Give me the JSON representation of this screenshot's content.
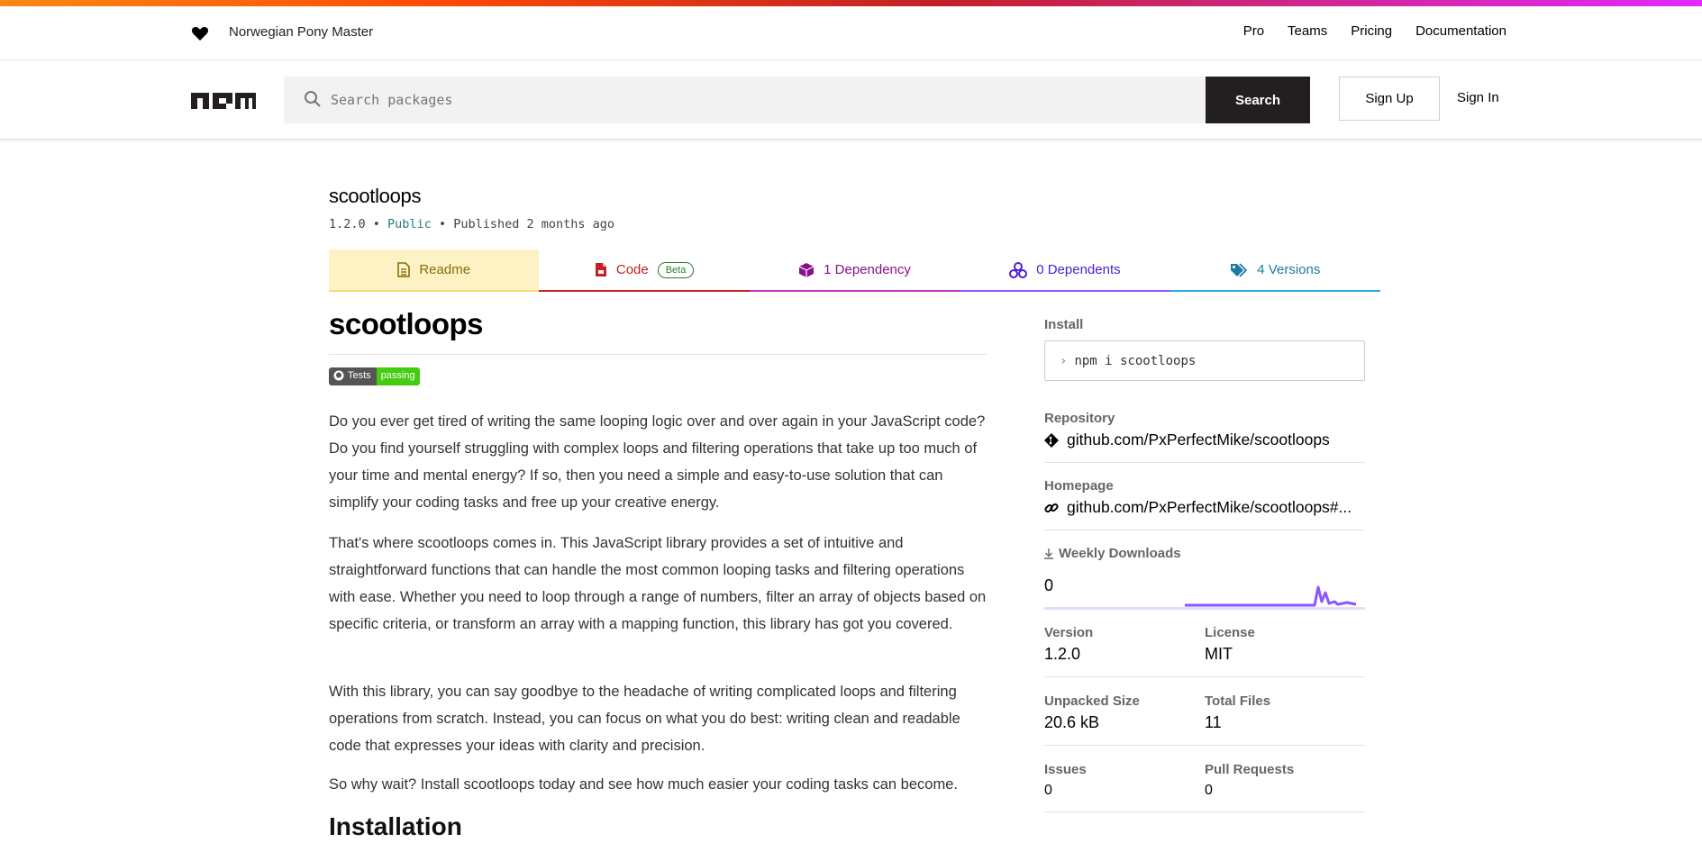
{
  "top_bar": {
    "tagline": "Norwegian Pony Master",
    "nav": [
      "Pro",
      "Teams",
      "Pricing",
      "Documentation"
    ]
  },
  "header": {
    "search_placeholder": "Search packages",
    "search_button": "Search",
    "signup_label": "Sign Up",
    "signin_label": "Sign In"
  },
  "package": {
    "name": "scootloops",
    "version": "1.2.0",
    "visibility": "Public",
    "published": "Published 2 months ago"
  },
  "tabs": {
    "readme": "Readme",
    "code": "Code",
    "code_badge": "Beta",
    "dependency": "1 Dependency",
    "dependents": "0 Dependents",
    "versions": "4 Versions"
  },
  "readme": {
    "title": "scootloops",
    "badge_left": "Tests",
    "badge_right": "passing",
    "paragraphs": [
      "Do you ever get tired of writing the same looping logic over and over again in your JavaScript code? Do you find yourself struggling with complex loops and filtering operations that take up too much of your time and mental energy? If so, then you need a simple and easy-to-use solution that can simplify your coding tasks and free up your creative energy.",
      "That's where scootloops comes in. This JavaScript library provides a set of intuitive and straightforward functions that can handle the most common looping tasks and filtering operations with ease. Whether you need to loop through a range of numbers, filter an array of objects based on specific criteria, or transform an array with a mapping function, this library has got you covered.",
      "With this library, you can say goodbye to the headache of writing complicated loops and filtering operations from scratch. Instead, you can focus on what you do best: writing clean and readable code that expresses your ideas with clarity and precision.",
      "So why wait? Install scootloops today and see how much easier your coding tasks can become."
    ],
    "installation_heading": "Installation"
  },
  "sidebar": {
    "install_label": "Install",
    "install_command": "npm i scootloops",
    "repository_label": "Repository",
    "repository_value": "github.com/PxPerfectMike/scootloops",
    "homepage_label": "Homepage",
    "homepage_value": "github.com/PxPerfectMike/scootloops#...",
    "weekly_downloads_label": "Weekly Downloads",
    "weekly_downloads_value": "0",
    "version_label": "Version",
    "version_value": "1.2.0",
    "license_label": "License",
    "license_value": "MIT",
    "unpacked_size_label": "Unpacked Size",
    "unpacked_size_value": "20.6 kB",
    "total_files_label": "Total Files",
    "total_files_value": "11",
    "issues_label": "Issues",
    "issues_value": "0",
    "pull_requests_label": "Pull Requests",
    "pull_requests_value": "0"
  },
  "colors": {
    "accent_dark": "#231f20",
    "readme_tab_bg": "#fcf2c4",
    "code_red": "#c12127",
    "sparkline": "#8956ff"
  }
}
